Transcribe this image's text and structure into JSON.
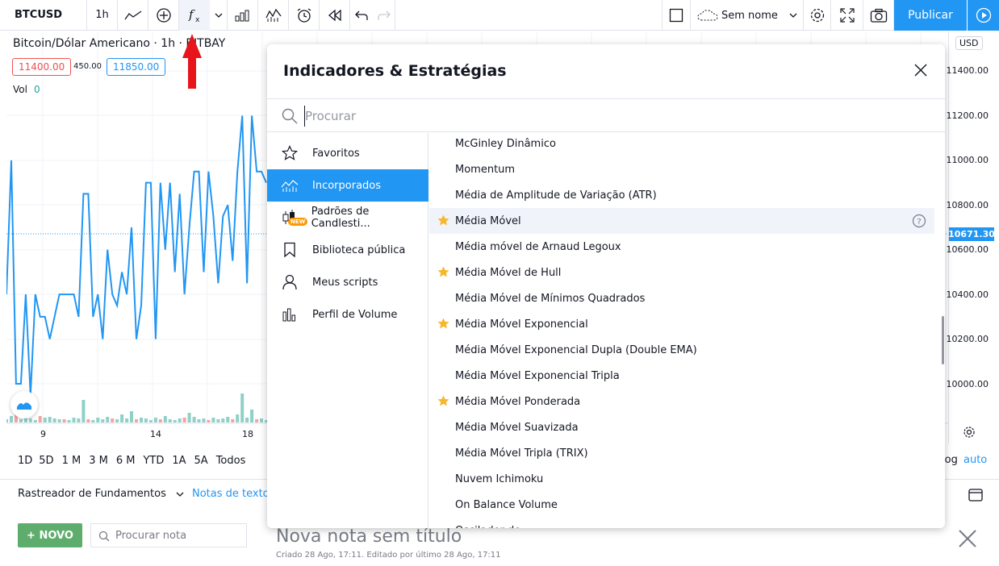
{
  "toolbar": {
    "symbol": "BTCUSD",
    "interval": "1h",
    "layout_name": "Sem nome",
    "publish_label": "Publicar",
    "icons": [
      "line-tool-icon",
      "add-compare-icon",
      "indicators-fx-icon",
      "chevron-down-icon",
      "bar-style-icon",
      "templates-icon",
      "alert-icon",
      "replay-icon",
      "undo-icon",
      "redo-icon",
      "fullscreen-square-icon",
      "cloud-icon",
      "settings-gear-icon",
      "fullscreen-icon",
      "camera-icon",
      "play-icon"
    ]
  },
  "chart": {
    "legend_title": "Bitcoin/Dólar Americano · 1h · BITBAY",
    "bid": "11400.00",
    "spread": "450.00",
    "ask": "11850.00",
    "vol_label": "Vol",
    "vol_value": "0",
    "currency": "USD",
    "current_price": "10671.30",
    "price_axis": [
      "11400.00",
      "11200.00",
      "11000.00",
      "10800.00",
      "10600.00",
      "10400.00",
      "10200.00",
      "10000.00"
    ],
    "date_labels": [
      "9",
      "14",
      "18"
    ],
    "ranges": [
      "1D",
      "5D",
      "1 M",
      "3 M",
      "6 M",
      "YTD",
      "1A",
      "5A",
      "Todos"
    ],
    "log_label": "log",
    "auto_label": "auto",
    "colors": {
      "line": "#2196f3",
      "vol_up": "#8fd0c9",
      "vol_down": "#f4a3a3"
    },
    "series": [
      10400,
      11000,
      10000,
      10000,
      10400,
      9950,
      10400,
      10300,
      10300,
      10200,
      10300,
      10400,
      10400,
      10400,
      10400,
      10300,
      10850,
      10850,
      10300,
      10400,
      10200,
      10600,
      10400,
      10350,
      10500,
      10400,
      10700,
      10200,
      10350,
      10900,
      10900,
      10200,
      10900,
      10600,
      10900,
      10500,
      10850,
      10400,
      10700,
      10950,
      10950,
      10500,
      10950,
      10750,
      10450,
      10750,
      10800,
      10550,
      10950,
      11200,
      10450,
      11200,
      10950,
      10950,
      10900
    ]
  },
  "modal": {
    "title": "Indicadores & Estratégias",
    "search_placeholder": "Procurar",
    "sidebar": [
      {
        "label": "Favoritos",
        "icon": "star-outline-icon"
      },
      {
        "label": "Incorporados",
        "icon": "chart-builtins-icon"
      },
      {
        "label": "Padrões de Candlesti...",
        "icon": "candlestick-icon",
        "badge": "NEW"
      },
      {
        "label": "Biblioteca pública",
        "icon": "bookmark-icon"
      },
      {
        "label": "Meus scripts",
        "icon": "user-icon"
      },
      {
        "label": "Perfil de Volume",
        "icon": "volume-profile-icon"
      }
    ],
    "items": [
      {
        "label": "McGinley Dinâmico",
        "fav": false
      },
      {
        "label": "Momentum",
        "fav": false
      },
      {
        "label": "Média de Amplitude de Variação (ATR)",
        "fav": false
      },
      {
        "label": "Média Móvel",
        "fav": true
      },
      {
        "label": "Média móvel de Arnaud Legoux",
        "fav": false
      },
      {
        "label": "Média Móvel de Hull",
        "fav": true
      },
      {
        "label": "Média Móvel de Mínimos Quadrados",
        "fav": false
      },
      {
        "label": "Média Móvel Exponencial",
        "fav": true
      },
      {
        "label": "Média Móvel Exponencial Dupla (Double EMA)",
        "fav": false
      },
      {
        "label": "Média Móvel Exponencial Tripla",
        "fav": false
      },
      {
        "label": "Média Móvel Ponderada",
        "fav": true
      },
      {
        "label": "Média Móvel Suavizada",
        "fav": false
      },
      {
        "label": "Média Móvel Tripla (TRIX)",
        "fav": false
      },
      {
        "label": "Nuvem Ichimoku",
        "fav": false
      },
      {
        "label": "On Balance Volume",
        "fav": false
      },
      {
        "label": "Oscilador de",
        "fav": false
      }
    ]
  },
  "bottom": {
    "screener_label": "Rastreador de Fundamentos",
    "notes_tab": "Notas de texto",
    "new_button": "+ NOVO",
    "note_search_placeholder": "Procurar nota",
    "note_title": "Nova nota sem título",
    "note_meta": "Criado 28 Ago, 17:11. Editado por último 28 Ago, 17:11"
  }
}
